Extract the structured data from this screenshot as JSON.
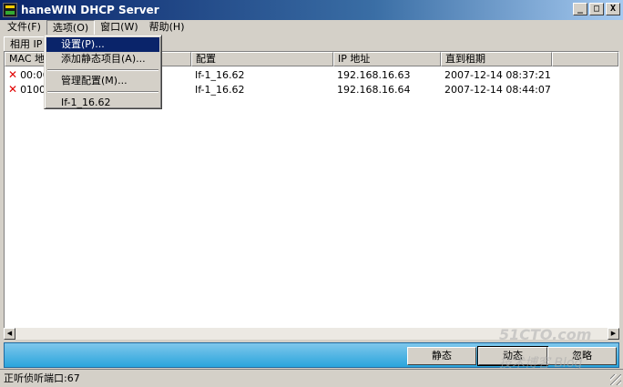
{
  "window": {
    "title": "haneWIN DHCP Server",
    "min": "_",
    "max": "□",
    "close": "X"
  },
  "menu": [
    "文件(F)",
    "选项(O)",
    "窗口(W)",
    "帮助(H)"
  ],
  "tab": "相用 IP 地址",
  "columns": [
    "MAC 地址",
    "配置",
    "IP 地址",
    "直到租期"
  ],
  "rows": [
    {
      "mac": "00:00",
      "config": "If-1_16.62",
      "ip": "192.168.16.63",
      "until": "2007-12-14  08:37:21"
    },
    {
      "mac": "01000",
      "config": "If-1_16.62",
      "ip": "192.168.16.64",
      "until": "2007-12-14  08:44:07"
    }
  ],
  "dropdown": {
    "items": [
      "设置(P)...",
      "添加静态项目(A)...",
      "管理配置(M)...",
      "If-1_16.62"
    ]
  },
  "buttons": {
    "static": "静态",
    "dynamic": "动态",
    "ignore": "忽略"
  },
  "status": "正听侦听端口:67",
  "watermark": {
    "line1": "51CTO.com",
    "line2": "技术博客 Blog"
  },
  "colors": {
    "title_start": "#0a246a",
    "title_end": "#a6caf0",
    "button_bar": "#2aa5dc",
    "highlight": "#0a246a",
    "error_x": "#e00000"
  }
}
